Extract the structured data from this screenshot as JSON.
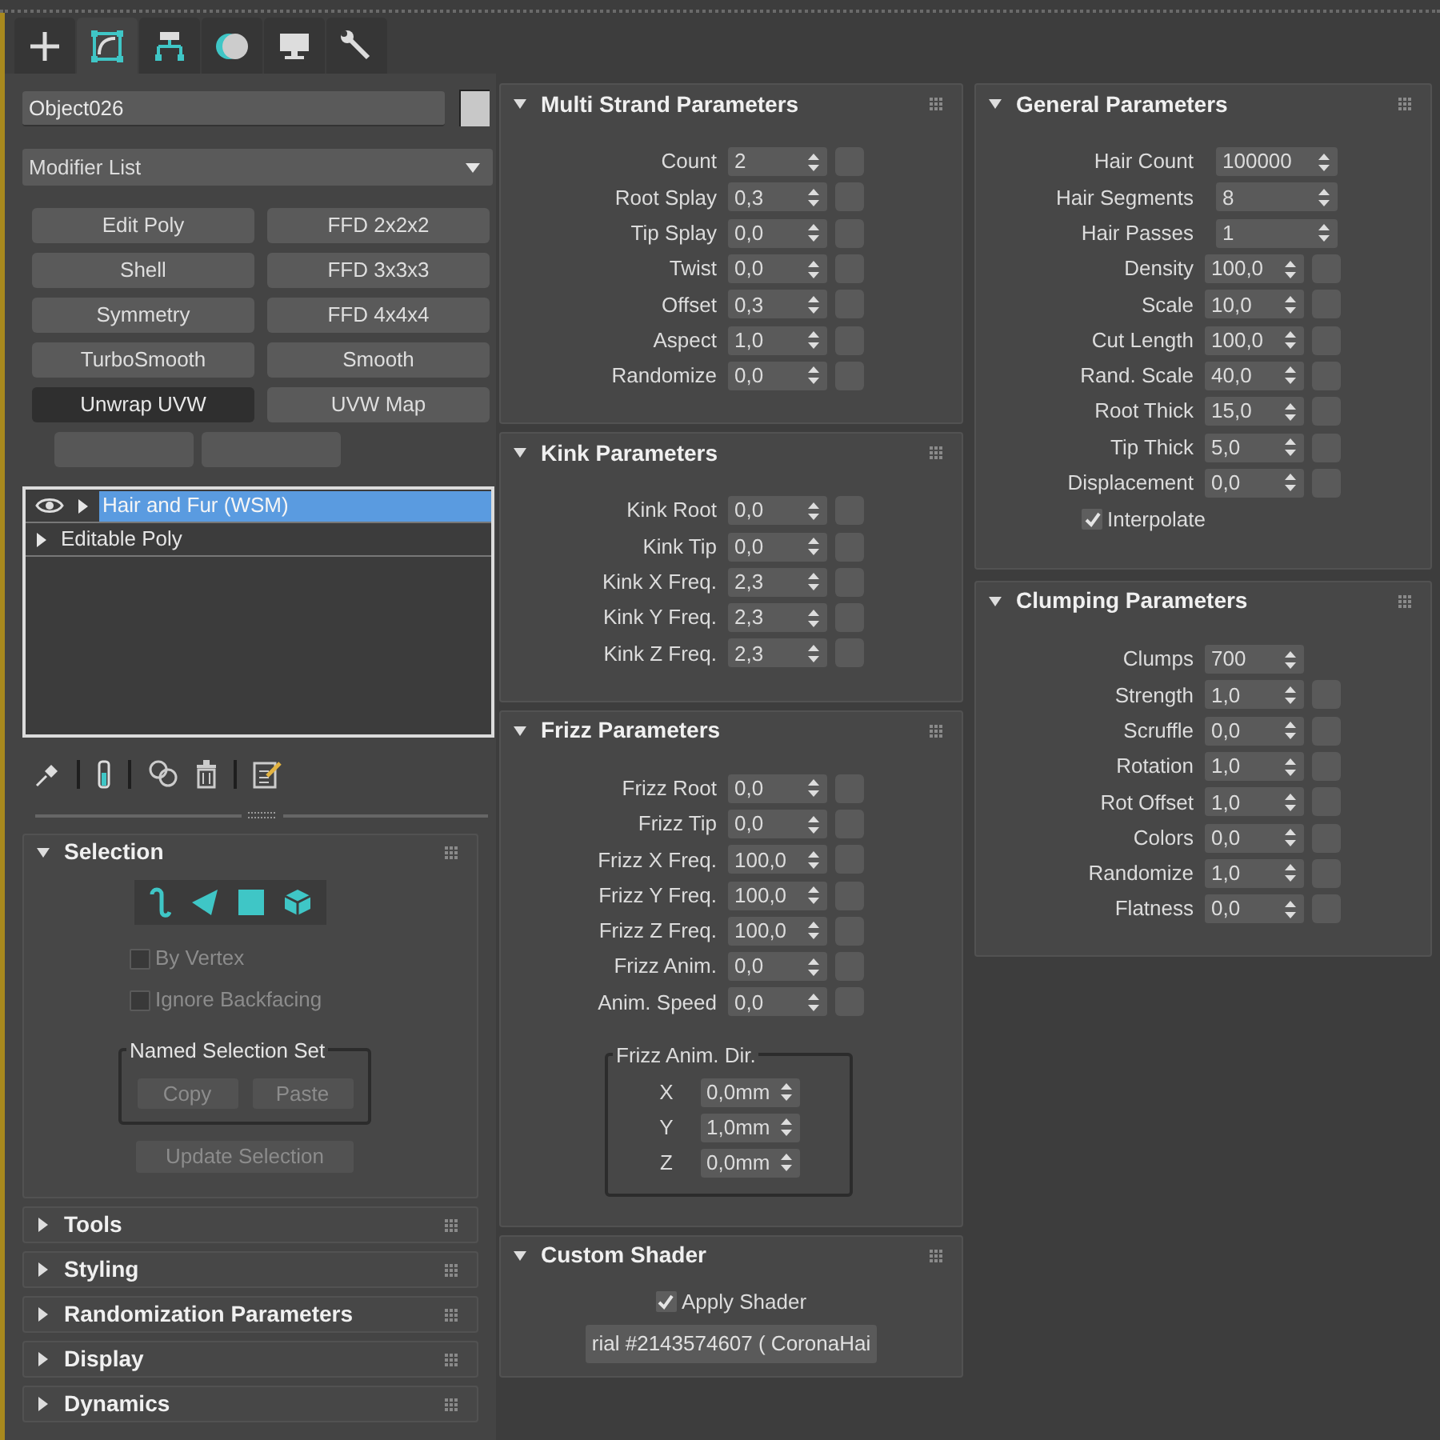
{
  "command_tabs": [
    {
      "kind": "create",
      "selected": false
    },
    {
      "kind": "modify",
      "selected": true
    },
    {
      "kind": "hierarchy",
      "selected": false
    },
    {
      "kind": "motion",
      "selected": false
    },
    {
      "kind": "display",
      "selected": false
    },
    {
      "kind": "utilities",
      "selected": false
    }
  ],
  "object_name": "Object026",
  "modifier_list": "Modifier List",
  "modifier_buttons": [
    {
      "label": "Edit Poly",
      "selected": false
    },
    {
      "label": "FFD 2x2x2",
      "selected": false
    },
    {
      "label": "Shell",
      "selected": false
    },
    {
      "label": "FFD 3x3x3",
      "selected": false
    },
    {
      "label": "Symmetry",
      "selected": false
    },
    {
      "label": "FFD 4x4x4",
      "selected": false
    },
    {
      "label": "TurboSmooth",
      "selected": false
    },
    {
      "label": "Smooth",
      "selected": false
    },
    {
      "label": "Unwrap UVW",
      "selected": true
    },
    {
      "label": "UVW Map",
      "selected": false
    }
  ],
  "modifier_stack": [
    {
      "label": "Hair and Fur (WSM)",
      "selected": true,
      "visible": true,
      "expanded": false
    },
    {
      "label": "Editable Poly",
      "selected": false,
      "visible": false,
      "expanded": false
    }
  ],
  "left_rollouts": [
    {
      "title": "Selection",
      "expanded": true,
      "checkboxes": [
        {
          "label": "By Vertex",
          "checked": false,
          "disabled": true
        },
        {
          "label": "Ignore Backfacing",
          "checked": false,
          "disabled": true
        }
      ],
      "named_selection_set": {
        "title": "Named Selection Set",
        "buttons": [
          {
            "label": "Copy",
            "disabled": true
          },
          {
            "label": "Paste",
            "disabled": true
          }
        ]
      },
      "update_button": {
        "label": "Update Selection",
        "disabled": true
      }
    },
    {
      "title": "Tools",
      "expanded": false
    },
    {
      "title": "Styling",
      "expanded": false
    },
    {
      "title": "Randomization Parameters",
      "expanded": false
    },
    {
      "title": "Display",
      "expanded": false
    },
    {
      "title": "Dynamics",
      "expanded": false
    }
  ],
  "middle_rollouts": [
    {
      "title": "Multi Strand Parameters",
      "expanded": true,
      "rows": [
        {
          "label": "Count",
          "value": "2",
          "kind": "mapped"
        },
        {
          "label": "Root Splay",
          "value": "0,3",
          "kind": "mapped"
        },
        {
          "label": "Tip Splay",
          "value": "0,0",
          "kind": "mapped"
        },
        {
          "label": "Twist",
          "value": "0,0",
          "kind": "mapped"
        },
        {
          "label": "Offset",
          "value": "0,3",
          "kind": "mapped"
        },
        {
          "label": "Aspect",
          "value": "1,0",
          "kind": "mapped"
        },
        {
          "label": "Randomize",
          "value": "0,0",
          "kind": "mapped"
        }
      ]
    },
    {
      "title": "Kink Parameters",
      "expanded": true,
      "rows": [
        {
          "label": "Kink Root",
          "value": "0,0",
          "kind": "mapped"
        },
        {
          "label": "Kink Tip",
          "value": "0,0",
          "kind": "mapped"
        },
        {
          "label": "Kink X Freq.",
          "value": "2,3",
          "kind": "mapped"
        },
        {
          "label": "Kink Y Freq.",
          "value": "2,3",
          "kind": "mapped"
        },
        {
          "label": "Kink Z Freq.",
          "value": "2,3",
          "kind": "mapped"
        }
      ]
    },
    {
      "title": "Frizz Parameters",
      "expanded": true,
      "rows": [
        {
          "label": "Frizz Root",
          "value": "0,0",
          "kind": "mapped"
        },
        {
          "label": "Frizz Tip",
          "value": "0,0",
          "kind": "mapped"
        },
        {
          "label": "Frizz X Freq.",
          "value": "100,0",
          "kind": "mapped"
        },
        {
          "label": "Frizz Y Freq.",
          "value": "100,0",
          "kind": "mapped"
        },
        {
          "label": "Frizz Z Freq.",
          "value": "100,0",
          "kind": "mapped"
        },
        {
          "label": "Frizz Anim.",
          "value": "0,0",
          "kind": "mapped"
        },
        {
          "label": "Anim. Speed",
          "value": "0,0",
          "kind": "mapped"
        }
      ],
      "group": {
        "title": "Frizz Anim. Dir.",
        "rows": [
          {
            "label": "X",
            "value": "0,0mm"
          },
          {
            "label": "Y",
            "value": "1,0mm"
          },
          {
            "label": "Z",
            "value": "0,0mm"
          }
        ]
      }
    },
    {
      "title": "Custom Shader",
      "expanded": true,
      "checkboxes": [
        {
          "label": "Apply Shader",
          "checked": true,
          "disabled": false
        }
      ],
      "material_button": "rial #2143574607 ( CoronaHai"
    }
  ],
  "right_rollouts": [
    {
      "title": "General Parameters",
      "expanded": true,
      "rows": [
        {
          "label": "Hair Count",
          "value": "100000",
          "kind": "wide"
        },
        {
          "label": "Hair Segments",
          "value": "8",
          "kind": "wide"
        },
        {
          "label": "Hair Passes",
          "value": "1",
          "kind": "wide"
        },
        {
          "label": "Density",
          "value": "100,0",
          "kind": "mapped"
        },
        {
          "label": "Scale",
          "value": "10,0",
          "kind": "mapped"
        },
        {
          "label": "Cut Length",
          "value": "100,0",
          "kind": "mapped"
        },
        {
          "label": "Rand. Scale",
          "value": "40,0",
          "kind": "mapped"
        },
        {
          "label": "Root Thick",
          "value": "15,0",
          "kind": "mapped"
        },
        {
          "label": "Tip Thick",
          "value": "5,0",
          "kind": "mapped"
        },
        {
          "label": "Displacement",
          "value": "0,0",
          "kind": "mapped"
        }
      ],
      "checkboxes": [
        {
          "label": "Interpolate",
          "checked": true,
          "disabled": false
        }
      ]
    },
    {
      "title": "Clumping Parameters",
      "expanded": true,
      "rows": [
        {
          "label": "Clumps",
          "value": "700",
          "kind": "plain"
        },
        {
          "label": "Strength",
          "value": "1,0",
          "kind": "mapped"
        },
        {
          "label": "Scruffle",
          "value": "0,0",
          "kind": "mapped"
        },
        {
          "label": "Rotation",
          "value": "1,0",
          "kind": "mapped"
        },
        {
          "label": "Rot Offset",
          "value": "1,0",
          "kind": "mapped"
        },
        {
          "label": "Colors",
          "value": "0,0",
          "kind": "mapped"
        },
        {
          "label": "Randomize",
          "value": "1,0",
          "kind": "mapped"
        },
        {
          "label": "Flatness",
          "value": "0,0",
          "kind": "mapped"
        }
      ]
    }
  ]
}
